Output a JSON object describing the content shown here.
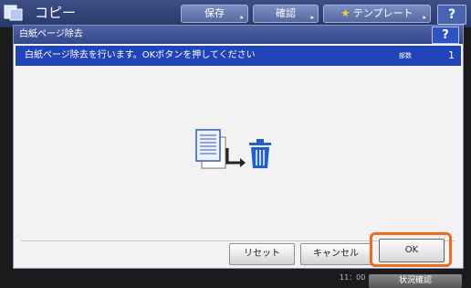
{
  "app": {
    "title": "コピー",
    "buttons": {
      "save": "保存",
      "confirm": "確認",
      "template": "テンプレート",
      "help": "?"
    }
  },
  "dialog": {
    "title": "白紙ページ除去",
    "help": "?",
    "message": "白紙ページ除去を行います。OKボタンを押してください",
    "copies_label": "部数",
    "copies_value": "1"
  },
  "buttons": {
    "reset": "リセット",
    "cancel": "キャンセル",
    "ok": "OK"
  },
  "status": {
    "time": "11：00",
    "status_label": "状況確認"
  },
  "colors": {
    "header_blue": "#32468a",
    "message_blue": "#1f45b8",
    "highlight": "#f26a1b"
  }
}
